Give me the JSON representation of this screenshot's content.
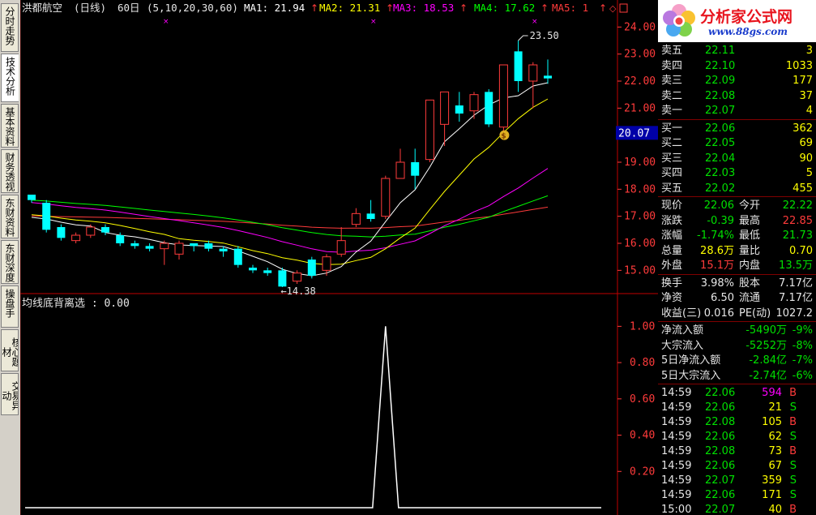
{
  "app": {
    "left_tabs": [
      "分时走势",
      "技术分析",
      "基本资料",
      "财务透视",
      "东财资料",
      "东财深度",
      "操盘手",
      "核心题材",
      "交易异动"
    ],
    "active_tab": 1
  },
  "chart": {
    "stock_name": "洪都航空",
    "period": "(日线)",
    "bar_count": "60日",
    "ma_params": "(5,10,20,30,60)",
    "ma": [
      {
        "label": "MA1: 21.94",
        "color": "#ffffff"
      },
      {
        "label": "MA2: 21.31",
        "color": "#ffff00"
      },
      {
        "label": "MA3: 18.53",
        "color": "#ff00ff"
      },
      {
        "label": "MA4: 17.62",
        "color": "#00ff00"
      },
      {
        "label": "MA5: 1",
        "color": "#ff3b3b"
      }
    ],
    "price_axis": [
      "24.00",
      "23.00",
      "22.00",
      "21.00",
      "20.00",
      "19.00",
      "18.00",
      "17.00",
      "16.00",
      "15.00"
    ],
    "current_price_tag": "20.07",
    "high_marker": "23.50",
    "low_marker": "14.38",
    "indicator_title": "均线底背离选 : 0.00",
    "indicator_axis": [
      "1.00",
      "0.80",
      "0.60",
      "0.40",
      "0.20"
    ],
    "colors": {
      "up": "#ff3b3b",
      "down": "#00ffff",
      "grid": "#800000",
      "axis_text": "#ff3b3b"
    }
  },
  "chart_data": {
    "type": "candlestick",
    "price_range": [
      14.2,
      24.4
    ],
    "candles": [
      {
        "o": 17.8,
        "c": 17.6,
        "h": 17.8,
        "l": 17.5
      },
      {
        "o": 17.5,
        "c": 16.5,
        "h": 17.6,
        "l": 16.4
      },
      {
        "o": 16.6,
        "c": 16.2,
        "h": 16.7,
        "l": 16.1
      },
      {
        "o": 16.1,
        "c": 16.3,
        "h": 16.4,
        "l": 16.0
      },
      {
        "o": 16.3,
        "c": 16.6,
        "h": 16.7,
        "l": 16.2
      },
      {
        "o": 16.6,
        "c": 16.4,
        "h": 16.7,
        "l": 16.3
      },
      {
        "o": 16.3,
        "c": 16.0,
        "h": 16.4,
        "l": 15.9
      },
      {
        "o": 16.0,
        "c": 15.9,
        "h": 16.1,
        "l": 15.8
      },
      {
        "o": 15.9,
        "c": 15.8,
        "h": 16.0,
        "l": 15.7
      },
      {
        "o": 15.8,
        "c": 16.0,
        "h": 16.1,
        "l": 15.2
      },
      {
        "o": 15.6,
        "c": 16.0,
        "h": 16.1,
        "l": 15.4
      },
      {
        "o": 16.0,
        "c": 15.9,
        "h": 16.0,
        "l": 15.7
      },
      {
        "o": 16.0,
        "c": 15.8,
        "h": 16.1,
        "l": 15.7
      },
      {
        "o": 15.8,
        "c": 15.7,
        "h": 15.9,
        "l": 15.5
      },
      {
        "o": 15.8,
        "c": 15.2,
        "h": 15.9,
        "l": 15.1
      },
      {
        "o": 15.1,
        "c": 15.0,
        "h": 15.2,
        "l": 14.9
      },
      {
        "o": 15.0,
        "c": 14.9,
        "h": 15.1,
        "l": 14.8
      },
      {
        "o": 15.0,
        "c": 14.4,
        "h": 15.1,
        "l": 14.38
      },
      {
        "o": 14.6,
        "c": 14.9,
        "h": 15.0,
        "l": 14.5
      },
      {
        "o": 15.4,
        "c": 14.8,
        "h": 15.5,
        "l": 14.7
      },
      {
        "o": 15.0,
        "c": 15.5,
        "h": 15.6,
        "l": 14.8
      },
      {
        "o": 15.6,
        "c": 16.1,
        "h": 16.6,
        "l": 15.5
      },
      {
        "o": 16.7,
        "c": 17.1,
        "h": 17.3,
        "l": 16.6
      },
      {
        "o": 17.1,
        "c": 16.9,
        "h": 17.6,
        "l": 16.8
      },
      {
        "o": 17.0,
        "c": 18.4,
        "h": 18.5,
        "l": 16.9
      },
      {
        "o": 18.4,
        "c": 19.0,
        "h": 19.5,
        "l": 18.4
      },
      {
        "o": 19.0,
        "c": 18.5,
        "h": 19.5,
        "l": 18.0
      },
      {
        "o": 19.1,
        "c": 21.3,
        "h": 21.3,
        "l": 19.0
      },
      {
        "o": 20.4,
        "c": 21.6,
        "h": 21.6,
        "l": 19.6
      },
      {
        "o": 21.1,
        "c": 20.8,
        "h": 21.6,
        "l": 20.5
      },
      {
        "o": 20.9,
        "c": 21.5,
        "h": 21.6,
        "l": 20.6
      },
      {
        "o": 21.6,
        "c": 20.4,
        "h": 21.7,
        "l": 20.3
      },
      {
        "o": 20.3,
        "c": 22.6,
        "h": 22.6,
        "l": 20.1
      },
      {
        "o": 23.1,
        "c": 22.0,
        "h": 23.5,
        "l": 21.6
      },
      {
        "o": 22.0,
        "c": 22.6,
        "h": 22.7,
        "l": 21.0
      },
      {
        "o": 22.2,
        "c": 22.1,
        "h": 22.8,
        "l": 21.9
      }
    ],
    "indicator_range": [
      0,
      1.1
    ],
    "signal_index": 24
  },
  "quote": {
    "logo_title": "分析家公式网",
    "logo_url": "www.88gs.com",
    "asks": [
      {
        "label": "卖五",
        "price": "22.11",
        "vol": "3"
      },
      {
        "label": "卖四",
        "price": "22.10",
        "vol": "1033"
      },
      {
        "label": "卖三",
        "price": "22.09",
        "vol": "177"
      },
      {
        "label": "卖二",
        "price": "22.08",
        "vol": "37"
      },
      {
        "label": "卖一",
        "price": "22.07",
        "vol": "4"
      }
    ],
    "bids": [
      {
        "label": "买一",
        "price": "22.06",
        "vol": "362"
      },
      {
        "label": "买二",
        "price": "22.05",
        "vol": "69"
      },
      {
        "label": "买三",
        "price": "22.04",
        "vol": "90"
      },
      {
        "label": "买四",
        "price": "22.03",
        "vol": "5"
      },
      {
        "label": "买五",
        "price": "22.02",
        "vol": "455"
      }
    ],
    "stats": [
      {
        "l1": "现价",
        "v1": "22.06",
        "c1": "grn",
        "l2": "今开",
        "v2": "22.22",
        "c2": "grn"
      },
      {
        "l1": "涨跌",
        "v1": "-0.39",
        "c1": "grn",
        "l2": "最高",
        "v2": "22.85",
        "c2": "red"
      },
      {
        "l1": "涨幅",
        "v1": "-1.74%",
        "c1": "grn",
        "l2": "最低",
        "v2": "21.73",
        "c2": "grn"
      },
      {
        "l1": "总量",
        "v1": "28.6万",
        "c1": "yel",
        "l2": "量比",
        "v2": "0.70",
        "c2": "yel"
      },
      {
        "l1": "外盘",
        "v1": "15.1万",
        "c1": "red",
        "l2": "内盘",
        "v2": "13.5万",
        "c2": "grn"
      }
    ],
    "stats2": [
      {
        "l1": "换手",
        "v1": "3.98%",
        "l2": "股本",
        "v2": "7.17亿"
      },
      {
        "l1": "净资",
        "v1": "6.50",
        "l2": "流通",
        "v2": "7.17亿"
      },
      {
        "l1": "收益(三)",
        "v1": "0.016",
        "l2": "PE(动)",
        "v2": "1027.2"
      }
    ],
    "flows": [
      {
        "label": "净流入额",
        "value": "-5490万",
        "pct": "-9%"
      },
      {
        "label": "大宗流入",
        "value": "-5252万",
        "pct": "-8%"
      },
      {
        "label": "5日净流入额",
        "value": "-2.84亿",
        "pct": "-7%"
      },
      {
        "label": "5日大宗流入",
        "value": "-2.74亿",
        "pct": "-6%"
      }
    ],
    "ticks": [
      {
        "time": "14:59",
        "price": "22.06",
        "vol": "594",
        "side": "B",
        "vc": "mag",
        "sc": "red"
      },
      {
        "time": "14:59",
        "price": "22.06",
        "vol": "21",
        "side": "S",
        "vc": "yel",
        "sc": "grn"
      },
      {
        "time": "14:59",
        "price": "22.08",
        "vol": "105",
        "side": "B",
        "vc": "yel",
        "sc": "red"
      },
      {
        "time": "14:59",
        "price": "22.06",
        "vol": "62",
        "side": "S",
        "vc": "yel",
        "sc": "grn"
      },
      {
        "time": "14:59",
        "price": "22.08",
        "vol": "73",
        "side": "B",
        "vc": "yel",
        "sc": "red"
      },
      {
        "time": "14:59",
        "price": "22.06",
        "vol": "67",
        "side": "S",
        "vc": "yel",
        "sc": "grn"
      },
      {
        "time": "14:59",
        "price": "22.07",
        "vol": "359",
        "side": "S",
        "vc": "yel",
        "sc": "grn"
      },
      {
        "time": "14:59",
        "price": "22.06",
        "vol": "171",
        "side": "S",
        "vc": "yel",
        "sc": "grn"
      },
      {
        "time": "15:00",
        "price": "22.07",
        "vol": "40",
        "side": "B",
        "vc": "yel",
        "sc": "red"
      }
    ]
  }
}
